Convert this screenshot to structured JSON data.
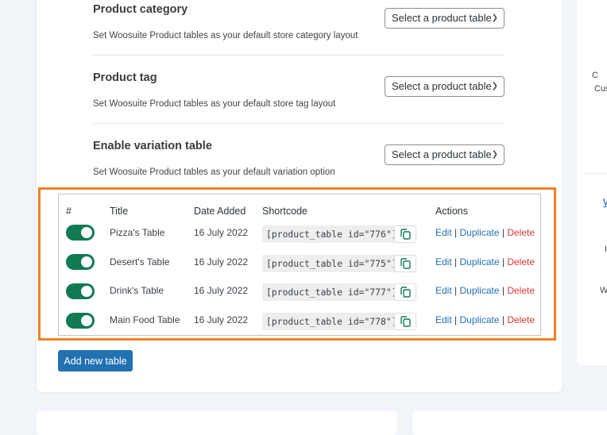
{
  "settings": [
    {
      "title": "Product category",
      "desc": "Set Woosuite Product tables as your default store category layout",
      "select": "Select a product table"
    },
    {
      "title": "Product tag",
      "desc": "Set Woosuite Product tables as your default store tag layout",
      "select": "Select a product table"
    },
    {
      "title": "Enable variation table",
      "desc": "Set Woosuite Product tables as your default variation option",
      "select": "Select a product table"
    }
  ],
  "table": {
    "headers": {
      "num": "#",
      "title": "Title",
      "date": "Date Added",
      "shortcode": "Shortcode",
      "actions": "Actions"
    },
    "rows": [
      {
        "title": "Pizza's Table",
        "date": "16 July 2022",
        "shortcode": "[product_table id=\"776\"]",
        "enabled": true
      },
      {
        "title": "Desert's Table",
        "date": "16 July 2022",
        "shortcode": "[product_table id=\"775\"]",
        "enabled": true
      },
      {
        "title": "Drink's Table",
        "date": "16 July 2022",
        "shortcode": "[product_table id=\"777\"]",
        "enabled": true
      },
      {
        "title": "Main Food Table",
        "date": "16 July 2022",
        "shortcode": "[product_table id=\"778\"]",
        "enabled": true
      }
    ],
    "actions": {
      "edit": "Edit",
      "sep": "|",
      "duplicate": "Duplicate",
      "delete": "Delete"
    }
  },
  "add_button": "Add new table",
  "sidebar_fragments": {
    "a": "C",
    "b": "Cus",
    "link": "W",
    "c": "I",
    "d": "W"
  },
  "colors": {
    "toggle_on": "#117a52",
    "highlight": "#f27f26",
    "primary": "#2271b1",
    "danger": "#d63638"
  }
}
